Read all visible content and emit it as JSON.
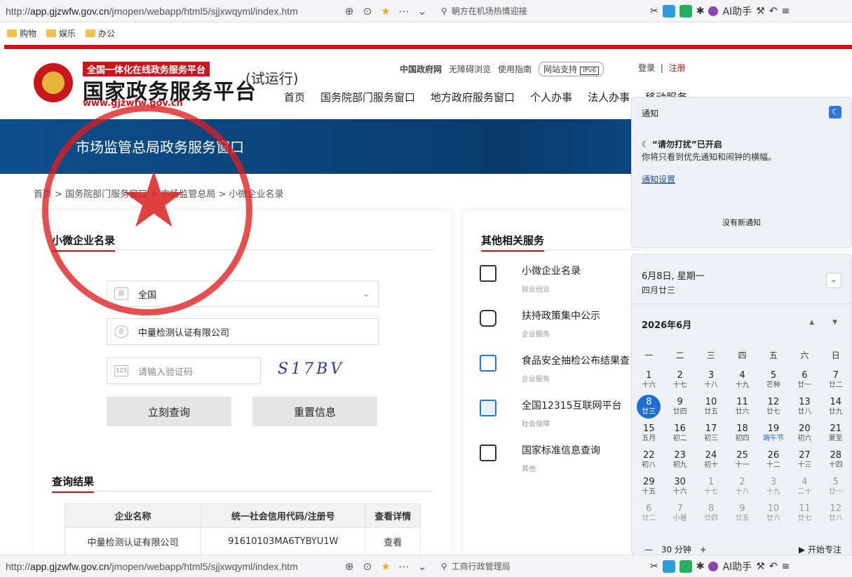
{
  "browser": {
    "url_prefix": "http://",
    "url_domain": "app.gjzwfw.gov.cn",
    "url_rest": "/jmopen/webapp/html5/sjjxwqyml/index.htm",
    "search_top": "朝方在机场热情迎接",
    "search_bottom": "工商行政管理局",
    "ai_label": "AI助手"
  },
  "bookmarks": [
    "购物",
    "娱乐",
    "办公"
  ],
  "header": {
    "platform_tag": "全国一体化在线政务服务平台",
    "site_name": "国家政务服务平台",
    "site_url": "www.gjzwfw.gov.cn",
    "trial": "(试运行)",
    "top_links": [
      "中国政府网",
      "无障碍浏览",
      "使用指南"
    ],
    "support": "网站支持",
    "ipv6": "IPv6",
    "login": "登录",
    "register": "注册",
    "separator": "|",
    "nav": [
      "首页",
      "国务院部门服务窗口",
      "地方政府服务窗口",
      "个人办事",
      "法人办事",
      "移动服务"
    ]
  },
  "banner_title": "市场监管总局政务服务窗口",
  "breadcrumb": "首页 > 国务院部门服务窗口 > 市场监管总局 > 小微企业名录",
  "search_panel": {
    "title": "小微企业名录",
    "region_value": "全国",
    "company_value": "中量检测认证有限公司",
    "captcha_placeholder": "请输入验证码",
    "captcha_code": "S17BV",
    "region_icon_text": "田",
    "company_icon_text": "企",
    "captcha_icon_text": "123",
    "query_button": "立刻查询",
    "reset_button": "重置信息"
  },
  "results": {
    "title": "查询结果",
    "columns": [
      "企业名称",
      "统一社会信用代码/注册号",
      "查看详情"
    ],
    "rows": [
      {
        "name": "中量检测认证有限公司",
        "code": "91610103MA6TYBYU1W",
        "action": "查看"
      }
    ]
  },
  "related": {
    "title": "其他相关服务",
    "items": [
      {
        "name": "小微企业名录",
        "category": "就业创业"
      },
      {
        "name": "扶持政策集中公示",
        "category": "企业服务"
      },
      {
        "name": "食品安全抽检公布结果查",
        "category": "企业服务"
      },
      {
        "name": "全国12315互联网平台",
        "category": "社会保障"
      },
      {
        "name": "国家标准信息查询",
        "category": "其他"
      }
    ]
  },
  "notification": {
    "title": "通知",
    "dnd_heading": "“请勿打扰”已开启",
    "dnd_body": "你将只看到优先通知和闹钟的横幅。",
    "settings_link": "通知设置",
    "empty": "没有新通知"
  },
  "calendar": {
    "date_line": "6月8日, 星期一",
    "lunar_line": "四月廿三",
    "month_title": "2026年6月",
    "weekdays": [
      "一",
      "二",
      "三",
      "四",
      "五",
      "六",
      "日"
    ],
    "days": [
      {
        "n": "1",
        "l": "十六"
      },
      {
        "n": "2",
        "l": "十七"
      },
      {
        "n": "3",
        "l": "十八"
      },
      {
        "n": "4",
        "l": "十九"
      },
      {
        "n": "5",
        "l": "芒种"
      },
      {
        "n": "6",
        "l": "廿一"
      },
      {
        "n": "7",
        "l": "廿二"
      },
      {
        "n": "8",
        "l": "廿三",
        "today": true
      },
      {
        "n": "9",
        "l": "廿四"
      },
      {
        "n": "10",
        "l": "廿五"
      },
      {
        "n": "11",
        "l": "廿六"
      },
      {
        "n": "12",
        "l": "廿七"
      },
      {
        "n": "13",
        "l": "廿八"
      },
      {
        "n": "14",
        "l": "廿九"
      },
      {
        "n": "15",
        "l": "五月"
      },
      {
        "n": "16",
        "l": "初二"
      },
      {
        "n": "17",
        "l": "初三"
      },
      {
        "n": "18",
        "l": "初四"
      },
      {
        "n": "19",
        "l": "端午节",
        "hl": true
      },
      {
        "n": "20",
        "l": "初六"
      },
      {
        "n": "21",
        "l": "夏至"
      },
      {
        "n": "22",
        "l": "初八"
      },
      {
        "n": "23",
        "l": "初九"
      },
      {
        "n": "24",
        "l": "初十"
      },
      {
        "n": "25",
        "l": "十一"
      },
      {
        "n": "26",
        "l": "十二"
      },
      {
        "n": "27",
        "l": "十三"
      },
      {
        "n": "28",
        "l": "十四"
      },
      {
        "n": "29",
        "l": "十五"
      },
      {
        "n": "30",
        "l": "十六"
      },
      {
        "n": "1",
        "l": "十七",
        "dim": true
      },
      {
        "n": "2",
        "l": "十八",
        "dim": true
      },
      {
        "n": "3",
        "l": "十九",
        "dim": true
      },
      {
        "n": "4",
        "l": "二十",
        "dim": true
      },
      {
        "n": "5",
        "l": "廿一",
        "dim": true
      },
      {
        "n": "6",
        "l": "廿二",
        "dim": true
      },
      {
        "n": "7",
        "l": "小暑",
        "dim": true
      },
      {
        "n": "8",
        "l": "廿四",
        "dim": true
      },
      {
        "n": "9",
        "l": "廿五",
        "dim": true
      },
      {
        "n": "10",
        "l": "廿六",
        "dim": true
      },
      {
        "n": "11",
        "l": "廿七",
        "dim": true
      },
      {
        "n": "12",
        "l": "廿八",
        "dim": true
      }
    ],
    "focus_minus": "—",
    "focus_value": "30 分钟",
    "focus_plus": "+",
    "start_focus": "▶ 开始专注"
  },
  "colors": {
    "brand_red": "#c8161d",
    "banner_blue": "#0e4f8c",
    "accent_blue": "#1f6fd0"
  }
}
